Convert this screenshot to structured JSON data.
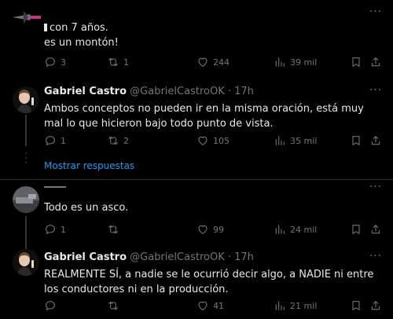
{
  "post1": {
    "text_line1": "con 7 años.",
    "text_line2": "es un montón!",
    "replies": "3",
    "retweets": "1",
    "likes": "244",
    "views": "39 mil"
  },
  "post2": {
    "name": "Gabriel Castro",
    "handle": "@GabrielCastroOK",
    "separator": "·",
    "time": "17h",
    "text": "Ambos conceptos no pueden ir en la misma oración, está muy mal lo que hicieron bajo todo punto de vista.",
    "replies": "1",
    "retweets": "2",
    "likes": "105",
    "views": "35 mil"
  },
  "show_replies": "Mostrar respuestas",
  "post3": {
    "text": "Todo es un asco.",
    "replies": "1",
    "retweets": "",
    "likes": "99",
    "views": "24 mil"
  },
  "post4": {
    "name": "Gabriel Castro",
    "handle": "@GabrielCastroOK",
    "separator": "·",
    "time": "17h",
    "text": "REALMENTE SÍ, a nadie se le ocurrió decir algo, a NADIE ni entre los conductores ni en la producción.",
    "replies": "",
    "retweets": "",
    "likes": "41",
    "views": "21 mil"
  },
  "icons": {
    "reply": "reply-icon",
    "retweet": "retweet-icon",
    "like": "heart-icon",
    "views": "views-icon",
    "bookmark": "bookmark-icon",
    "share": "share-icon",
    "more": "more-icon"
  },
  "colors": {
    "background": "#000000",
    "text": "#e7e9ea",
    "muted": "#71767b",
    "link": "#1d9bf0",
    "divider": "#2f3336"
  }
}
